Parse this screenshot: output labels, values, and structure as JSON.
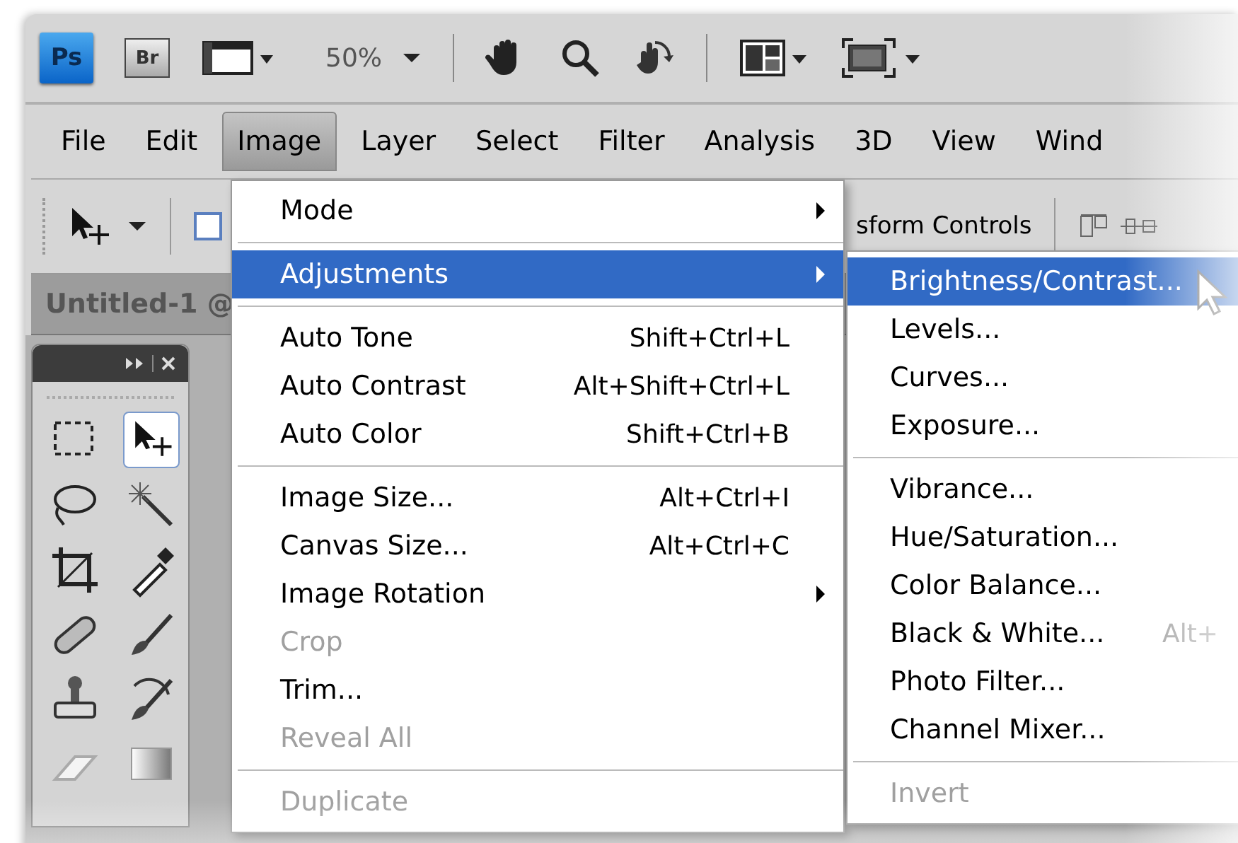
{
  "app_bar": {
    "logo": "Ps",
    "bridge": "Br",
    "zoom_level": "50%"
  },
  "menu_bar": [
    {
      "label": "File",
      "selected": false
    },
    {
      "label": "Edit",
      "selected": false
    },
    {
      "label": "Image",
      "selected": true
    },
    {
      "label": "Layer",
      "selected": false
    },
    {
      "label": "Select",
      "selected": false
    },
    {
      "label": "Filter",
      "selected": false
    },
    {
      "label": "Analysis",
      "selected": false
    },
    {
      "label": "3D",
      "selected": false
    },
    {
      "label": "View",
      "selected": false
    },
    {
      "label": "Wind",
      "selected": false
    }
  ],
  "options_bar": {
    "checkbox_checked": false,
    "label": "sform Controls"
  },
  "document_tab": {
    "title": "Untitled-1 @"
  },
  "image_menu": [
    {
      "kind": "item",
      "label": "Mode",
      "submenu": true,
      "selected": false,
      "disabled": false
    },
    {
      "kind": "separator"
    },
    {
      "kind": "item",
      "label": "Adjustments",
      "submenu": true,
      "selected": true,
      "disabled": false
    },
    {
      "kind": "separator"
    },
    {
      "kind": "item",
      "label": "Auto Tone",
      "shortcut": "Shift+Ctrl+L",
      "submenu": false,
      "selected": false,
      "disabled": false
    },
    {
      "kind": "item",
      "label": "Auto Contrast",
      "shortcut": "Alt+Shift+Ctrl+L",
      "submenu": false,
      "selected": false,
      "disabled": false
    },
    {
      "kind": "item",
      "label": "Auto Color",
      "shortcut": "Shift+Ctrl+B",
      "submenu": false,
      "selected": false,
      "disabled": false
    },
    {
      "kind": "separator"
    },
    {
      "kind": "item",
      "label": "Image Size...",
      "shortcut": "Alt+Ctrl+I",
      "submenu": false,
      "selected": false,
      "disabled": false
    },
    {
      "kind": "item",
      "label": "Canvas Size...",
      "shortcut": "Alt+Ctrl+C",
      "submenu": false,
      "selected": false,
      "disabled": false
    },
    {
      "kind": "item",
      "label": "Image Rotation",
      "submenu": true,
      "selected": false,
      "disabled": false
    },
    {
      "kind": "item",
      "label": "Crop",
      "submenu": false,
      "selected": false,
      "disabled": true
    },
    {
      "kind": "item",
      "label": "Trim...",
      "submenu": false,
      "selected": false,
      "disabled": false
    },
    {
      "kind": "item",
      "label": "Reveal All",
      "submenu": false,
      "selected": false,
      "disabled": true
    },
    {
      "kind": "separator"
    },
    {
      "kind": "item",
      "label": "Duplicate",
      "submenu": false,
      "selected": false,
      "disabled": true
    }
  ],
  "adjustments_menu": [
    {
      "kind": "item",
      "label": "Brightness/Contrast...",
      "selected": true,
      "disabled": false
    },
    {
      "kind": "item",
      "label": "Levels...",
      "selected": false,
      "disabled": false
    },
    {
      "kind": "item",
      "label": "Curves...",
      "selected": false,
      "disabled": false
    },
    {
      "kind": "item",
      "label": "Exposure...",
      "selected": false,
      "disabled": false
    },
    {
      "kind": "separator"
    },
    {
      "kind": "item",
      "label": "Vibrance...",
      "selected": false,
      "disabled": false
    },
    {
      "kind": "item",
      "label": "Hue/Saturation...",
      "selected": false,
      "disabled": false
    },
    {
      "kind": "item",
      "label": "Color Balance...",
      "selected": false,
      "disabled": false
    },
    {
      "kind": "item",
      "label": "Black & White...",
      "shortcut": "Alt+",
      "selected": false,
      "disabled": false
    },
    {
      "kind": "item",
      "label": "Photo Filter...",
      "selected": false,
      "disabled": false
    },
    {
      "kind": "item",
      "label": "Channel Mixer...",
      "selected": false,
      "disabled": false
    },
    {
      "kind": "separator"
    },
    {
      "kind": "item",
      "label": "Invert",
      "selected": false,
      "disabled": true
    }
  ]
}
